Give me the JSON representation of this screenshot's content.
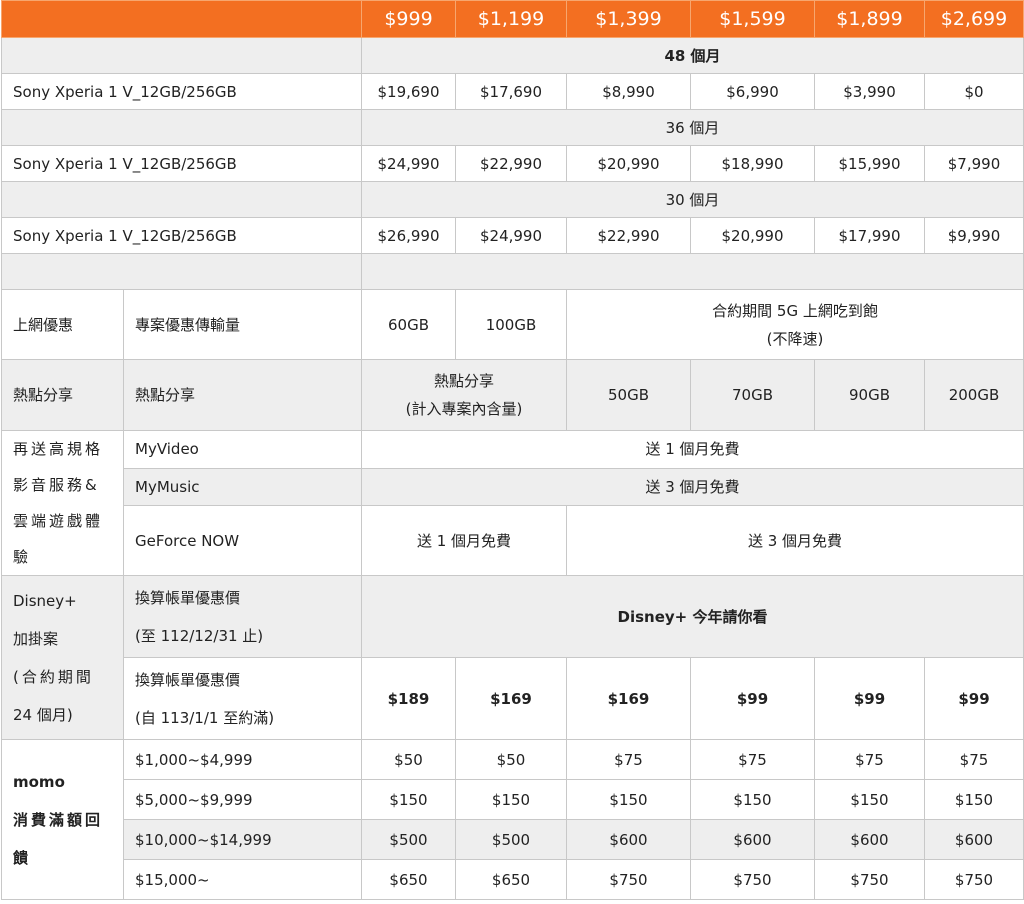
{
  "header": [
    "$999",
    "$1,199",
    "$1,399",
    "$1,599",
    "$1,899",
    "$2,699"
  ],
  "periods": [
    {
      "label": "48 個月",
      "device": "Sony Xperia 1 V_12GB/256GB",
      "prices": [
        "$19,690",
        "$17,690",
        "$8,990",
        "$6,990",
        "$3,990",
        "$0"
      ]
    },
    {
      "label": "36 個月",
      "device": "Sony Xperia 1 V_12GB/256GB",
      "prices": [
        "$24,990",
        "$22,990",
        "$20,990",
        "$18,990",
        "$15,990",
        "$7,990"
      ]
    },
    {
      "label": "30 個月",
      "device": "Sony Xperia 1 V_12GB/256GB",
      "prices": [
        "$26,990",
        "$24,990",
        "$22,990",
        "$20,990",
        "$17,990",
        "$9,990"
      ]
    }
  ],
  "data_plan": {
    "cat": "上網優惠",
    "sub": "專案優惠傳輸量",
    "v1": "60GB",
    "v2": "100GB",
    "unlimited_line1": "合約期間 5G 上網吃到飽",
    "unlimited_line2": "(不降速)"
  },
  "hotspot": {
    "cat": "熱點分享",
    "sub": "熱點分享",
    "inc_line1": "熱點分享",
    "inc_line2": "(計入專案內含量)",
    "values": [
      "50GB",
      "70GB",
      "90GB",
      "200GB"
    ]
  },
  "media": {
    "cat_lines": [
      "再送高規格",
      "影音服務&",
      "雲端遊戲體",
      "驗"
    ],
    "myvideo": "MyVideo",
    "myvideo_val": "送 1 個月免費",
    "mymusic": "MyMusic",
    "mymusic_val": "送 3 個月免費",
    "geforce": "GeForce NOW",
    "geforce_v1": "送 1 個月免費",
    "geforce_v2": "送 3 個月免費"
  },
  "disney": {
    "cat_lines": [
      "Disney+",
      "加掛案",
      "(合約期間",
      "24 個月)"
    ],
    "row1_line1": "換算帳單優惠價",
    "row1_line2": "(至 112/12/31 止)",
    "row1_val": "Disney+  今年請你看",
    "row2_line1": "換算帳單優惠價",
    "row2_line2": "(自 113/1/1 至約滿)",
    "row2_prices": [
      "$189",
      "$169",
      "$169",
      "$99",
      "$99",
      "$99"
    ]
  },
  "momo": {
    "cat_lines": [
      "momo",
      "消費滿額回",
      "饋"
    ],
    "rows": [
      {
        "range": "$1,000~$4,999",
        "prices": [
          "$50",
          "$50",
          "$75",
          "$75",
          "$75",
          "$75"
        ]
      },
      {
        "range": "$5,000~$9,999",
        "prices": [
          "$150",
          "$150",
          "$150",
          "$150",
          "$150",
          "$150"
        ]
      },
      {
        "range": "$10,000~$14,999",
        "prices": [
          "$500",
          "$500",
          "$600",
          "$600",
          "$600",
          "$600"
        ]
      },
      {
        "range": "$15,000~",
        "prices": [
          "$650",
          "$650",
          "$750",
          "$750",
          "$750",
          "$750"
        ]
      }
    ]
  }
}
